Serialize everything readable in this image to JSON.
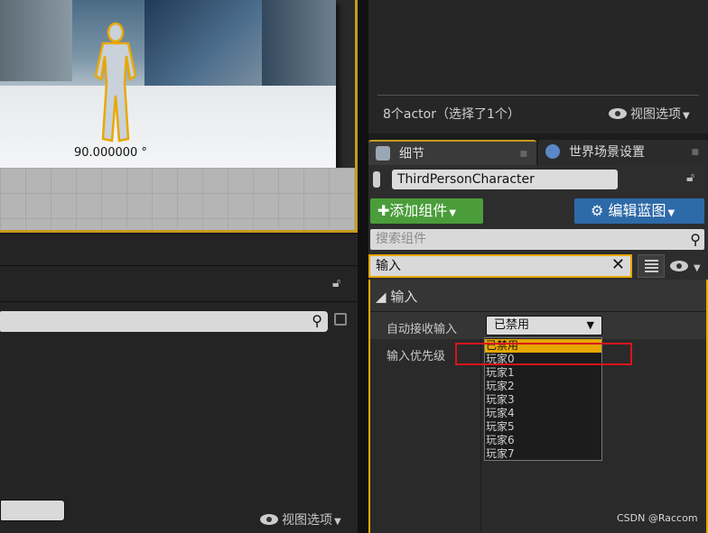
{
  "viewport": {
    "rotation_label": "90.000000 °"
  },
  "left_panel": {
    "view_options_label": "视图选项"
  },
  "outliner": {
    "actor_count": "8个actor（选择了1个）",
    "view_options_label": "视图选项"
  },
  "tabs": {
    "details": "细节",
    "world_settings": "世界场景设置"
  },
  "details": {
    "actor_name": "ThirdPersonCharacter",
    "add_component_label": "添加组件",
    "edit_blueprint_label": "编辑蓝图",
    "search_placeholder": "搜索组件",
    "filter_value": "输入",
    "category": "输入",
    "properties": [
      {
        "label": "自动接收输入",
        "value": "已禁用"
      },
      {
        "label": "输入优先级"
      }
    ]
  },
  "dropdown_menu": {
    "options": [
      "已禁用",
      "玩家0",
      "玩家1",
      "玩家2",
      "玩家3",
      "玩家4",
      "玩家5",
      "玩家6",
      "玩家7"
    ],
    "selected_index": 0
  },
  "colors": {
    "highlight": "#e8a800",
    "add_button": "#4a9d3a",
    "edit_button": "#2d6aa8",
    "annotation": "#d8141c"
  },
  "watermark": "CSDN @Raccom"
}
